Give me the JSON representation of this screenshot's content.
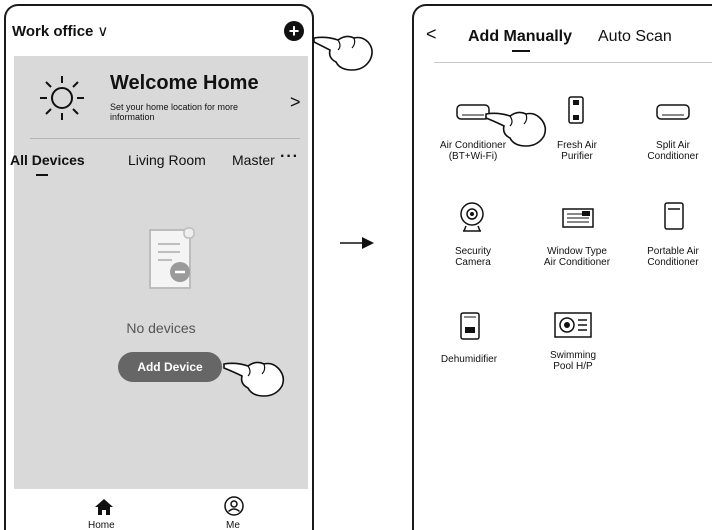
{
  "left_screen": {
    "location": "Work office",
    "welcome_title": "Welcome Home",
    "welcome_subtitle": "Set your home location for more information",
    "tabs": [
      "All Devices",
      "Living Room",
      "Master"
    ],
    "empty_text": "No devices",
    "add_device_label": "Add Device",
    "nav": {
      "home": "Home",
      "me": "Me"
    }
  },
  "right_screen": {
    "tab_manual": "Add Manually",
    "tab_auto": "Auto Scan",
    "devices": [
      {
        "label_line1": "Air Conditioner",
        "label_line2": "(BT+Wi-Fi)"
      },
      {
        "label_line1": "Fresh Air",
        "label_line2": "Purifier"
      },
      {
        "label_line1": "Split Air",
        "label_line2": "Conditioner"
      },
      {
        "label_line1": "Security",
        "label_line2": "Camera"
      },
      {
        "label_line1": "Window Type",
        "label_line2": "Air Conditioner"
      },
      {
        "label_line1": "Portable Air",
        "label_line2": "Conditioner"
      },
      {
        "label_line1": "Dehumidifier",
        "label_line2": ""
      },
      {
        "label_line1": "Swimming",
        "label_line2": "Pool H/P"
      }
    ]
  },
  "colors": {
    "panel_gray": "#d9d9d9",
    "button_gray": "#666666"
  }
}
